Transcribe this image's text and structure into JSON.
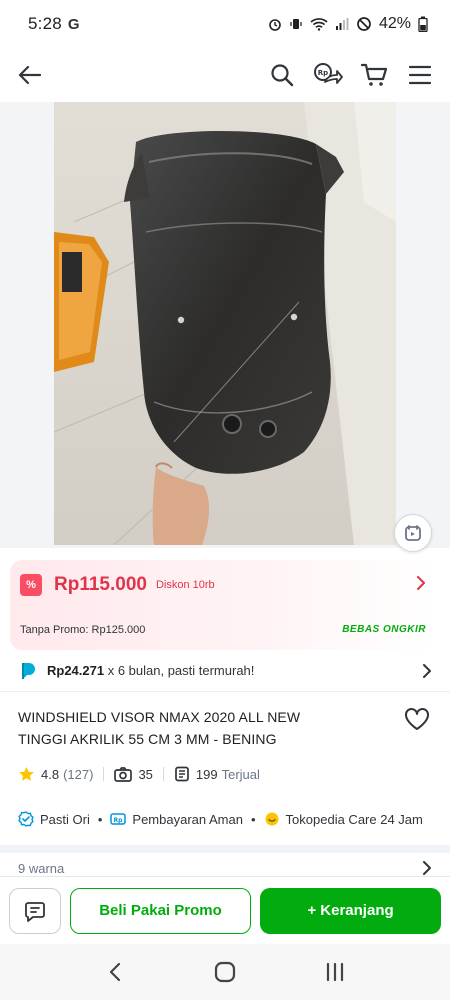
{
  "status_bar": {
    "time": "5:28",
    "carrier_icon": "google-g-icon",
    "battery": "42%"
  },
  "nav": {
    "icons": [
      "back-arrow-icon",
      "search-icon",
      "share-icon",
      "cart-icon",
      "menu-icon"
    ]
  },
  "price": {
    "current": "Rp115.000",
    "discount": "Diskon 10rb",
    "original": "Tanpa Promo: Rp125.000",
    "shipping": "BEBAS ONGKIR"
  },
  "installment": {
    "amount": "Rp24.271",
    "rest": " x 6 bulan, pasti termurah!"
  },
  "product": {
    "title_line1": "WINDSHIELD VISOR NMAX 2020 ALL NEW",
    "title_line2": "TINGGI AKRILIK 55 CM 3 MM - BENING",
    "rating": "4.8",
    "rating_count": "(127)",
    "photo_count": "35",
    "sold_count": "199",
    "sold_label": "Terjual"
  },
  "assurance": {
    "ori": "Pasti Ori",
    "payment": "Pembayaran Aman",
    "care": "Tokopedia Care 24 Jam"
  },
  "variant": {
    "label": "9 warna"
  },
  "bottom_bar": {
    "promo_label": "Beli Pakai Promo",
    "cart_label": "+ Keranjang"
  },
  "colors": {
    "brand_green": "#03ac0e",
    "price_red": "#e0344b"
  }
}
